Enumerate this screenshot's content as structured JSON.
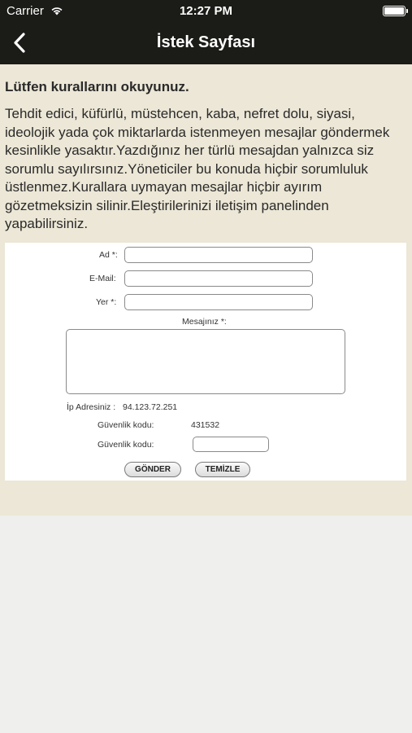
{
  "status_bar": {
    "carrier": "Carrier",
    "time": "12:27 PM",
    "battery_level": 1.0
  },
  "nav": {
    "title": "İstek Sayfası",
    "back_icon": "chevron-left-icon"
  },
  "rules": {
    "heading": "Lütfen kurallarını okuyunuz.",
    "body": "Tehdit edici, küfürlü, müstehcen, kaba, nefret dolu, siyasi, ideolojik yada çok miktarlarda istenmeyen mesajlar göndermek kesinlikle yasaktır.Yazdığınız her türlü mesajdan yalnızca siz sorumlu sayılırsınız.Yöneticiler bu konuda hiçbir sorumluluk üstlenmez.Kurallara uymayan mesajlar hiçbir ayırım gözetmeksizin silinir.Eleştirilerinizi iletişim panelinden yapabilirsiniz."
  },
  "form": {
    "name_label": "Ad *:",
    "name_value": "",
    "email_label": "E-Mail:",
    "email_value": "",
    "place_label": "Yer *:",
    "place_value": "",
    "message_label": "Mesajınız *:",
    "message_value": "",
    "ip_label": "İp Adresiniz :",
    "ip_value": "94.123.72.251",
    "security_code_label": "Güvenlik kodu:",
    "security_code_value": "431532",
    "security_input_label": "Güvenlik kodu:",
    "security_input_value": "",
    "submit_label": "GÖNDER",
    "clear_label": "TEMİZLE"
  },
  "colors": {
    "bar_background": "#1b1b17",
    "content_background": "#ece7d6",
    "page_background": "#efefed"
  }
}
